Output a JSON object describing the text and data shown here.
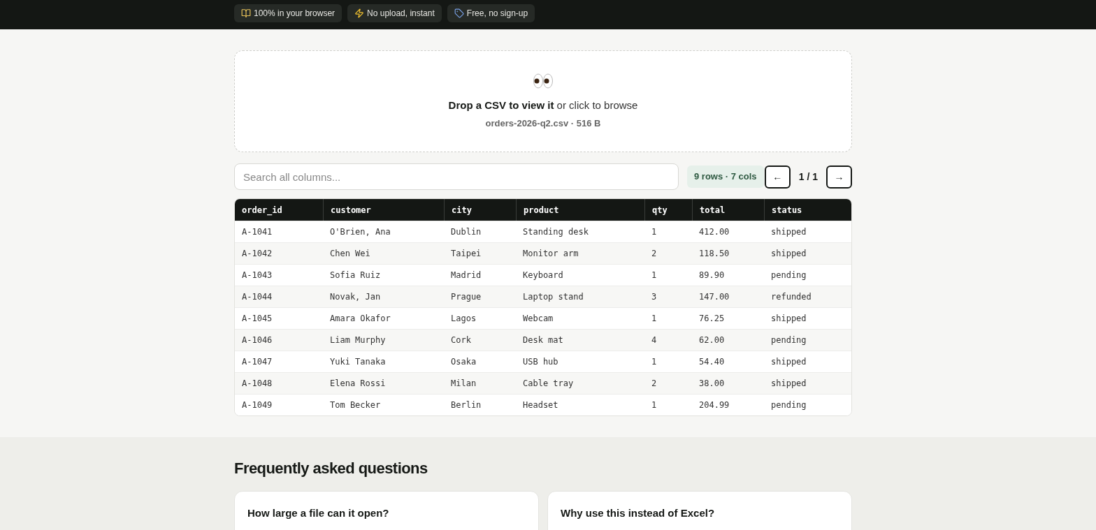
{
  "header": {
    "badges": [
      {
        "kind": "book",
        "label": "100% in your browser"
      },
      {
        "kind": "bolt",
        "label": "No upload, instant"
      },
      {
        "kind": "free",
        "label": "Free, no sign-up"
      }
    ]
  },
  "dropzone": {
    "title": "Drop a CSV to view it",
    "hint": "or click to browse",
    "file": "orders-2026-q2.csv · 516 B"
  },
  "toolbar": {
    "search": {
      "placeholder": "Search all columns..."
    },
    "summary": "9 rows · 7 cols",
    "prev": "←",
    "page": "1 / 1",
    "next": "→"
  },
  "table": {
    "columns": [
      "order_id",
      "customer",
      "city",
      "product",
      "qty",
      "total",
      "status"
    ],
    "rows": [
      [
        "A-1041",
        "O'Brien, Ana",
        "Dublin",
        "Standing desk",
        "1",
        "412.00",
        "shipped"
      ],
      [
        "A-1042",
        "Chen Wei",
        "Taipei",
        "Monitor arm",
        "2",
        "118.50",
        "shipped"
      ],
      [
        "A-1043",
        "Sofia Ruiz",
        "Madrid",
        "Keyboard",
        "1",
        "89.90",
        "pending"
      ],
      [
        "A-1044",
        "Novak, Jan",
        "Prague",
        "Laptop stand",
        "3",
        "147.00",
        "refunded"
      ],
      [
        "A-1045",
        "Amara Okafor",
        "Lagos",
        "Webcam",
        "1",
        "76.25",
        "shipped"
      ],
      [
        "A-1046",
        "Liam Murphy",
        "Cork",
        "Desk mat",
        "4",
        "62.00",
        "pending"
      ],
      [
        "A-1047",
        "Yuki Tanaka",
        "Osaka",
        "USB hub",
        "1",
        "54.40",
        "shipped"
      ],
      [
        "A-1048",
        "Elena Rossi",
        "Milan",
        "Cable tray",
        "2",
        "38.00",
        "shipped"
      ],
      [
        "A-1049",
        "Tom Becker",
        "Berlin",
        "Headset",
        "1",
        "204.99",
        "pending"
      ]
    ]
  },
  "faq": {
    "title": "Frequently asked questions",
    "questions": [
      "How large a file can it open?",
      "Why use this instead of Excel?"
    ]
  }
}
